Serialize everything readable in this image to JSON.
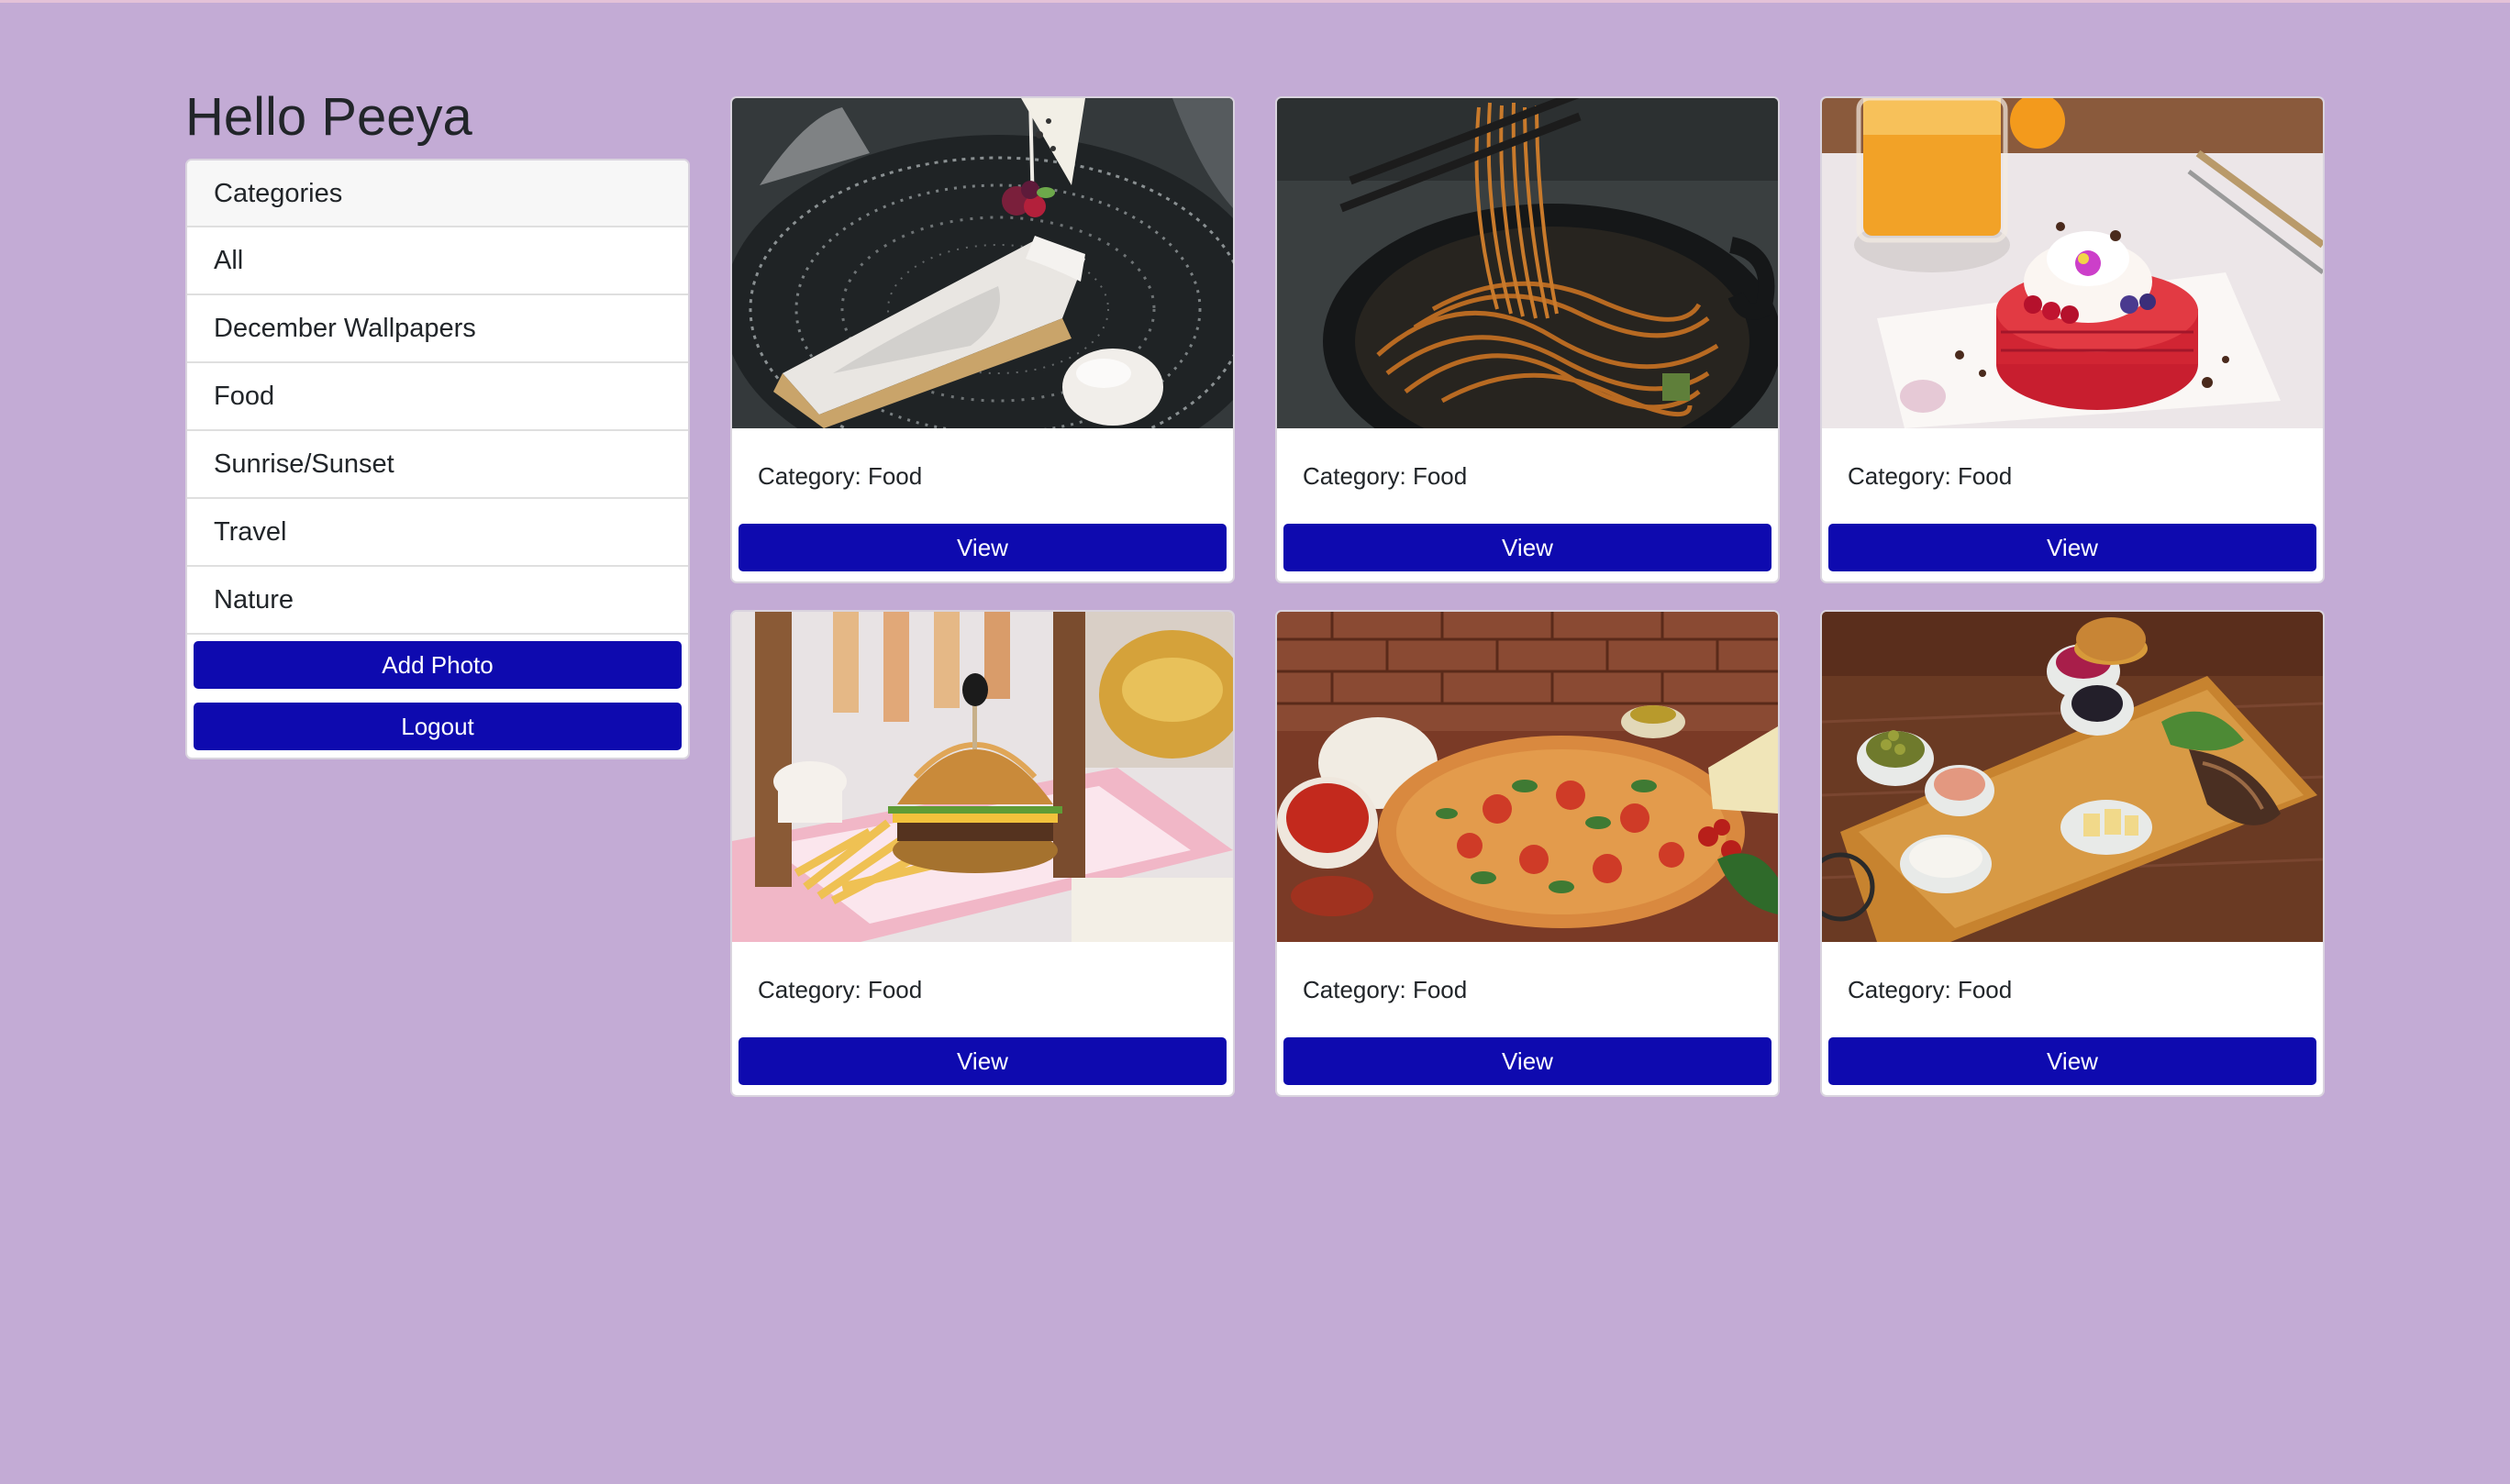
{
  "greeting": "Hello Peeya",
  "colors": {
    "background": "#c3abd5",
    "button": "#0e0aaf",
    "button_text": "#ffffff"
  },
  "sidebar": {
    "header": "Categories",
    "items": [
      {
        "label": "All"
      },
      {
        "label": "December Wallpapers"
      },
      {
        "label": "Food"
      },
      {
        "label": "Sunrise/Sunset"
      },
      {
        "label": "Travel"
      },
      {
        "label": "Nature"
      }
    ],
    "add_photo_label": "Add Photo",
    "logout_label": "Logout"
  },
  "photos": [
    {
      "category_text": "Category: Food",
      "view_label": "View",
      "subject": "cheesecake-slice"
    },
    {
      "category_text": "Category: Food",
      "view_label": "View",
      "subject": "noodles-bowl"
    },
    {
      "category_text": "Category: Food",
      "view_label": "View",
      "subject": "pancakes-stack"
    },
    {
      "category_text": "Category: Food",
      "view_label": "View",
      "subject": "burger-and-fries"
    },
    {
      "category_text": "Category: Food",
      "view_label": "View",
      "subject": "pizza"
    },
    {
      "category_text": "Category: Food",
      "view_label": "View",
      "subject": "appetizer-board"
    }
  ]
}
